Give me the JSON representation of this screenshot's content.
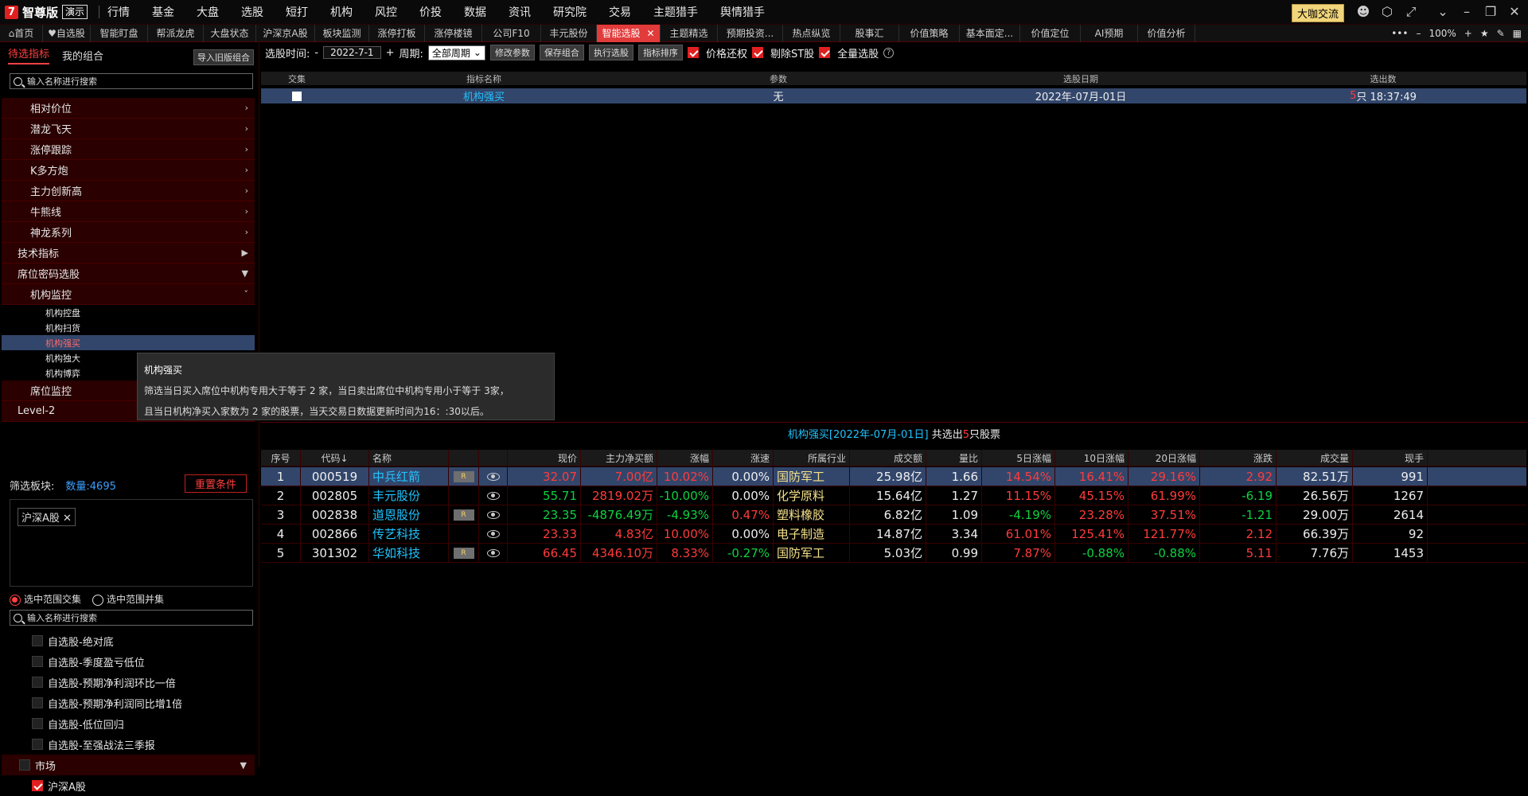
{
  "menubar": {
    "logo_text": "智尊版",
    "badge": "演示",
    "items": [
      "行情",
      "基金",
      "大盘",
      "选股",
      "短打",
      "机构",
      "风控",
      "价投",
      "数据",
      "资讯",
      "研究院",
      "交易",
      "主题猎手",
      "舆情猎手"
    ],
    "dakai": "大咖交流"
  },
  "tabs": [
    {
      "label": "首页",
      "icon": "home-icon"
    },
    {
      "label": "自选股",
      "icon": "heart-icon"
    },
    {
      "label": "智能盯盘"
    },
    {
      "label": "帮派龙虎"
    },
    {
      "label": "大盘状态"
    },
    {
      "label": "沪深京A股"
    },
    {
      "label": "板块监测"
    },
    {
      "label": "涨停打板"
    },
    {
      "label": "涨停楼镜"
    },
    {
      "label": "公司F10"
    },
    {
      "label": "丰元股份"
    },
    {
      "label": "智能选股",
      "active": true
    },
    {
      "label": "主题精选"
    },
    {
      "label": "预期投资..."
    },
    {
      "label": "热点纵览"
    },
    {
      "label": "股事汇"
    },
    {
      "label": "价值策略"
    },
    {
      "label": "基本面定..."
    },
    {
      "label": "价值定位"
    },
    {
      "label": "AI预期"
    },
    {
      "label": "价值分析"
    }
  ],
  "tab_right": {
    "zoom": "100%"
  },
  "left": {
    "tab_active": "待选指标",
    "tab_other": "我的组合",
    "import_btn": "导入旧版组合",
    "search_placeholder": "输入名称进行搜索",
    "tree": [
      {
        "label": "相对价位",
        "level": 2
      },
      {
        "label": "潜龙飞天",
        "level": 2
      },
      {
        "label": "涨停跟踪",
        "level": 2
      },
      {
        "label": "K多方炮",
        "level": 2
      },
      {
        "label": "主力创新高",
        "level": 2
      },
      {
        "label": "牛熊线",
        "level": 2
      },
      {
        "label": "神龙系列",
        "level": 2
      },
      {
        "label": "技术指标",
        "level": 1
      },
      {
        "label": "席位密码选股",
        "level": 1
      },
      {
        "label": "机构监控",
        "level": 2
      }
    ],
    "leaves": [
      "机构控盘",
      "机构扫货",
      "机构强买",
      "机构独大",
      "机构博弈"
    ],
    "tree_after": [
      {
        "label": "席位监控",
        "level": 2
      },
      {
        "label": "Level-2",
        "level": 1
      }
    ],
    "tooltip": {
      "title": "机构强买",
      "line1": "筛选当日买入席位中机构专用大于等于 2 家，当日卖出席位中机构专用小于等于 3家，",
      "line2": "且当日机构净买入家数为 2 家的股票，当天交易日数据更新时间为16：:30以后。"
    },
    "filter_label": "筛选板块:",
    "filter_count": "数量:4695",
    "reset_btn": "重置条件",
    "chip": "沪深A股",
    "radio1": "选中范围交集",
    "radio2": "选中范围并集",
    "search2_placeholder": "输入名称进行搜索",
    "checklist": [
      "自选股-绝对底",
      "自选股-季度盈亏低位",
      "自选股-预期净利润环比一倍",
      "自选股-预期净利润同比增1倍",
      "自选股-低位回归",
      "自选股-至强战法三季报"
    ],
    "market": "市场",
    "market_child": "沪深A股"
  },
  "toolbar": {
    "time_label": "选股时间:",
    "date": "2022-7-1",
    "period_label": "周期:",
    "period_value": "全部周期",
    "btn1": "修改参数",
    "btn2": "保存组合",
    "btn3": "执行选股",
    "btn4": "指标排序",
    "chk1": "价格还权",
    "chk2": "剔除ST股",
    "chk3": "全量选股"
  },
  "criteria": {
    "headers": [
      "交集",
      "指标名称",
      "参数",
      "选股日期",
      "选出数"
    ],
    "row": {
      "name": "机构强买",
      "param": "无",
      "date": "2022年-07月-01日",
      "count_num": "5",
      "count_rest": "只 18:37:49"
    }
  },
  "result": {
    "title_pre": "机构强买[2022年-07月-01日]",
    "title_mid": " 共选出",
    "title_num": "5",
    "title_post": "只股票",
    "headers": [
      "序号",
      "代码↓",
      "名称",
      "",
      "",
      "现价",
      "主力净买额",
      "涨幅",
      "涨速",
      "所属行业",
      "成交额",
      "量比",
      "5日涨幅",
      "10日涨幅",
      "20日涨幅",
      "涨跌",
      "成交量",
      "现手"
    ],
    "rows": [
      {
        "no": "1",
        "code": "000519",
        "name": "中兵红箭",
        "r": true,
        "price": "32.07",
        "net": "7.00亿",
        "chg": "10.02%",
        "speed": "0.00%",
        "ind": "国防军工",
        "amt": "25.98亿",
        "vr": "1.66",
        "d5": "14.54%",
        "d10": "16.41%",
        "d20": "29.16%",
        "diff": "2.92",
        "vol": "82.51万",
        "hand": "991"
      },
      {
        "no": "2",
        "code": "002805",
        "name": "丰元股份",
        "r": false,
        "price": "55.71",
        "net": "2819.02万",
        "chg": "-10.00%",
        "speed": "0.00%",
        "ind": "化学原料",
        "amt": "15.64亿",
        "vr": "1.27",
        "d5": "11.15%",
        "d10": "45.15%",
        "d20": "61.99%",
        "diff": "-6.19",
        "vol": "26.56万",
        "hand": "1267"
      },
      {
        "no": "3",
        "code": "002838",
        "name": "道恩股份",
        "r": true,
        "price": "23.35",
        "net": "-4876.49万",
        "chg": "-4.93%",
        "speed": "0.47%",
        "ind": "塑料橡胶",
        "amt": "6.82亿",
        "vr": "1.09",
        "d5": "-4.19%",
        "d10": "23.28%",
        "d20": "37.51%",
        "diff": "-1.21",
        "vol": "29.00万",
        "hand": "2614"
      },
      {
        "no": "4",
        "code": "002866",
        "name": "传艺科技",
        "r": false,
        "price": "23.33",
        "net": "4.83亿",
        "chg": "10.00%",
        "speed": "0.00%",
        "ind": "电子制造",
        "amt": "14.87亿",
        "vr": "3.34",
        "d5": "61.01%",
        "d10": "125.41%",
        "d20": "121.77%",
        "diff": "2.12",
        "vol": "66.39万",
        "hand": "92"
      },
      {
        "no": "5",
        "code": "301302",
        "name": "华如科技",
        "r": true,
        "price": "66.45",
        "net": "4346.10万",
        "chg": "8.33%",
        "speed": "-0.27%",
        "ind": "国防军工",
        "amt": "5.03亿",
        "vr": "0.99",
        "d5": "7.87%",
        "d10": "-0.88%",
        "d20": "-0.88%",
        "diff": "5.11",
        "vol": "7.76万",
        "hand": "1453"
      }
    ]
  },
  "colors": {
    "up": "#ff3b3b",
    "down": "#10d040",
    "accent": "#e13b3b",
    "selected": "#32466b"
  }
}
